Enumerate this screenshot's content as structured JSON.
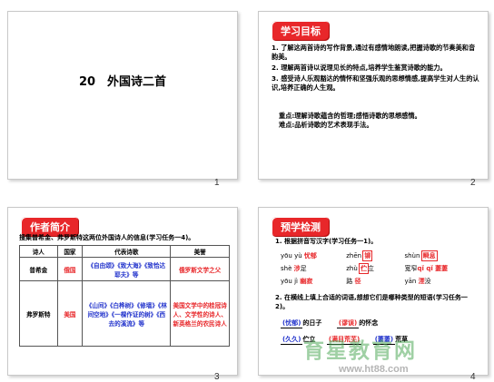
{
  "slides": [
    {
      "number": "1",
      "title": "20　外国诗二首"
    },
    {
      "number": "2",
      "badge": "学习目标",
      "objectives": [
        "1. 了解这两首诗的写作背景,通过有感情地朗读,把握诗歌的节奏美和音韵美。",
        "2. 理解两首诗以说理见长的特点,培养学生鉴赏诗歌的能力。",
        "3. 感受诗人乐观豁达的情怀和坚强乐观的思想情感,提高学生对人生的认识,培养正确的人生观。"
      ],
      "key_point": "重点:理解诗歌蕴含的哲理;感悟诗歌的思想感情。",
      "difficulty": "难点:品析诗歌的艺术表现手法。"
    },
    {
      "number": "3",
      "badge": "作者简介",
      "task": "搜集普希金、弗罗斯特这两位外国诗人的信息(学习任务一4)。",
      "headers": [
        "诗人",
        "国家",
        "代表诗歌",
        "美誉"
      ],
      "rows": [
        {
          "poet": "普希金",
          "country": "俄国",
          "works": "《自由颂》《致大海》《致恰达耶夫》等",
          "honor": "俄罗斯文学之父"
        },
        {
          "poet": "弗罗斯特",
          "country": "美国",
          "works": "《山间》《白桦树》《修墙》《林间空地》《一棵作证的树》《西去的溪流》等",
          "honor": "美国文学中的桂冠诗人、文学性的诗人、新英格兰的农民诗人"
        }
      ]
    },
    {
      "number": "4",
      "badge": "预学检测",
      "q1": "1. 根据拼音写汉字(学习任务一1)。",
      "pinyin_rows": [
        [
          {
            "py": "yōu yù",
            "ans": "忧郁"
          },
          {
            "py": "zhēn",
            "ans": "铆"
          },
          {
            "py": "shùn",
            "ans": "瞬息"
          }
        ],
        [
          {
            "py": "shè",
            "ans": "涉",
            "suffix": "足"
          },
          {
            "py": "zhù",
            "ans": "伫",
            "suffix": "立"
          },
          {
            "py": "",
            "pre": "宽窄",
            "ans": "qǐ qǐ 萋萋"
          }
        ],
        [
          {
            "py": "yōu jì",
            "ans": "幽寂"
          },
          {
            "py": "",
            "pre": "路",
            "ans": "径"
          },
          {
            "py": "yān",
            "ans": "湮",
            "suffix": "没"
          }
        ]
      ],
      "q2": "2. 在横线上填上合适的词语,想想它们是哪种类型的短语(学习任务一2)。",
      "fill_rows": [
        {
          "a": "(忧郁)",
          "a_suffix": "的日子",
          "b": "(谬误)",
          "b_suffix": "的怀念",
          "c": "(瞬息)",
          "c_suffix": ""
        },
        {
          "a": "(久久)",
          "a_suffix": "伫立",
          "b": "(满目荒芜)",
          "b_suffix": "",
          "c": "(萋萋)",
          "c_suffix": "荒草"
        }
      ]
    }
  ],
  "watermark": {
    "text": "育星教育网",
    "url": "www.ht88.com"
  }
}
